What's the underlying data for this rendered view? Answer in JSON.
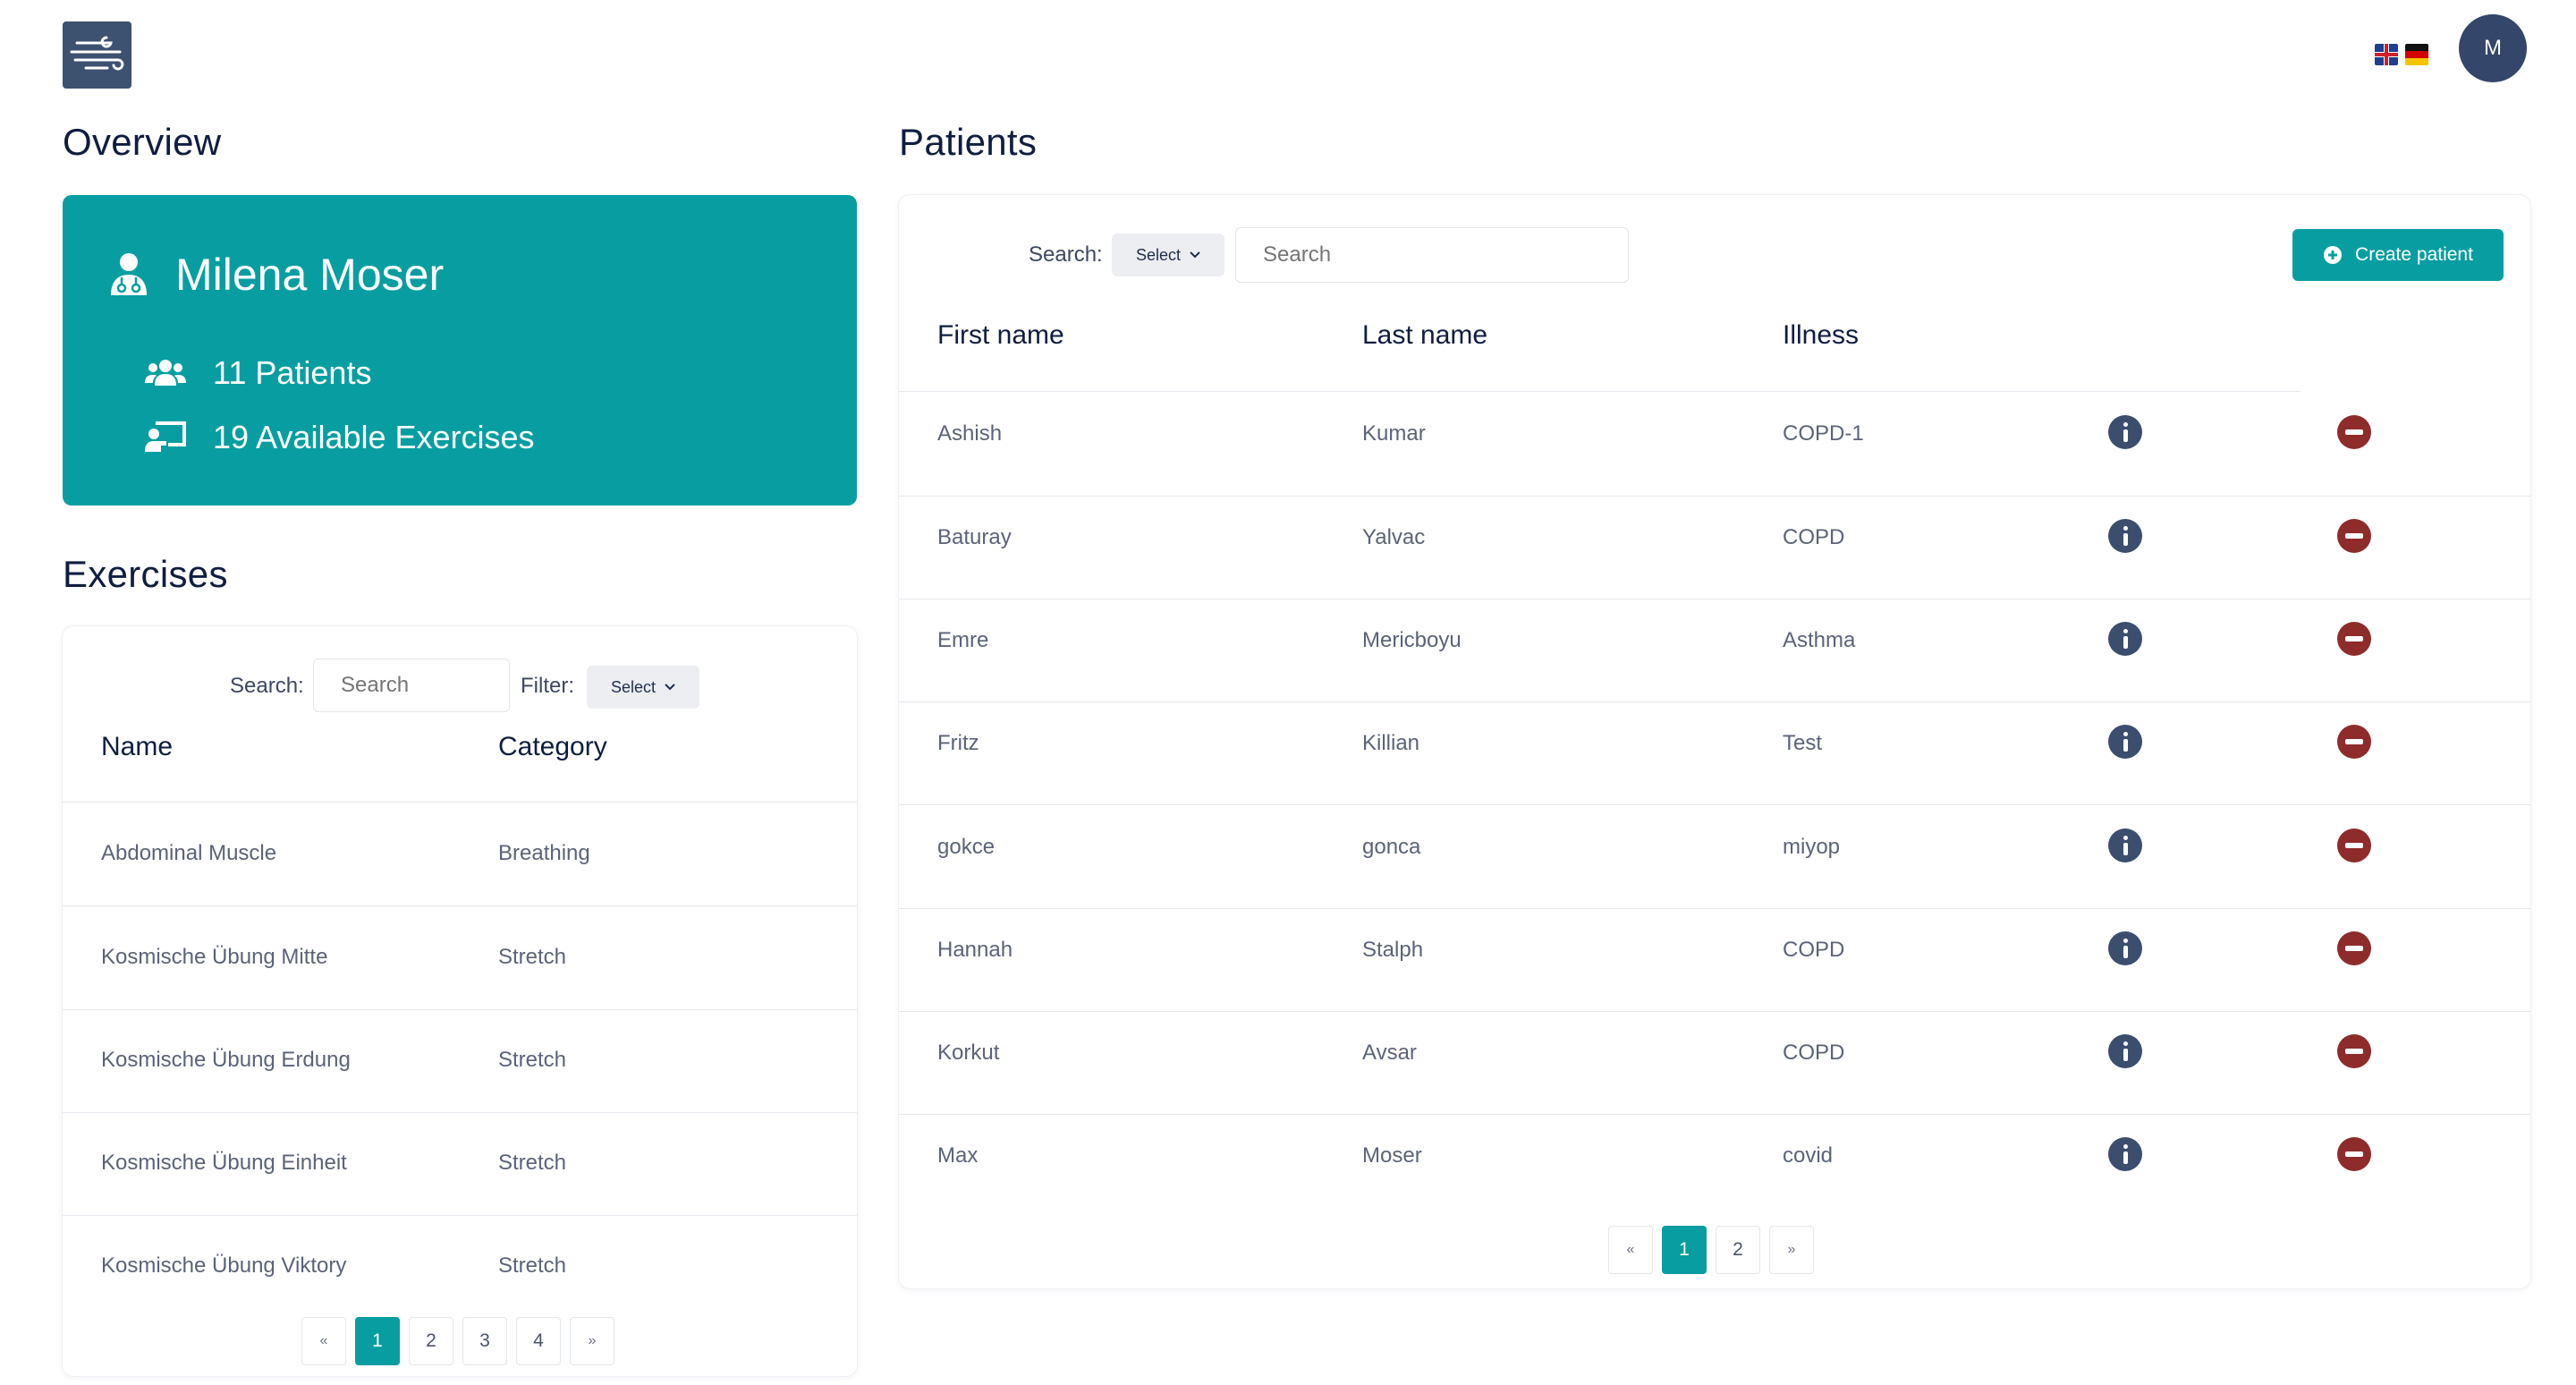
{
  "header": {
    "logo_icon": "wind-icon",
    "avatar_initial": "M",
    "languages": [
      "en",
      "de"
    ]
  },
  "overview": {
    "title": "Overview",
    "therapist_name": "Milena Moser",
    "patients_text": "11 Patients",
    "exercises_text": "19 Available Exercises"
  },
  "exercises": {
    "title": "Exercises",
    "search_label": "Search:",
    "search_placeholder": "Search",
    "filter_label": "Filter:",
    "filter_select": "Select",
    "columns": [
      "Name",
      "Category"
    ],
    "rows": [
      {
        "name": "Abdominal Muscle",
        "category": "Breathing"
      },
      {
        "name": "Kosmische Übung Mitte",
        "category": "Stretch"
      },
      {
        "name": "Kosmische Übung Erdung",
        "category": "Stretch"
      },
      {
        "name": "Kosmische Übung Einheit",
        "category": "Stretch"
      },
      {
        "name": "Kosmische Übung Viktory",
        "category": "Stretch"
      }
    ],
    "pagination": {
      "prev": "«",
      "pages": [
        "1",
        "2",
        "3",
        "4"
      ],
      "next": "»",
      "current": "1"
    }
  },
  "patients": {
    "title": "Patients",
    "search_label": "Search:",
    "search_select": "Select",
    "search_placeholder": "Search",
    "create_button": "Create patient",
    "columns": [
      "First name",
      "Last name",
      "Illness"
    ],
    "rows": [
      {
        "first": "Ashish",
        "last": "Kumar",
        "illness": "COPD-1"
      },
      {
        "first": "Baturay",
        "last": "Yalvac",
        "illness": "COPD"
      },
      {
        "first": "Emre",
        "last": "Mericboyu",
        "illness": "Asthma"
      },
      {
        "first": "Fritz",
        "last": "Killian",
        "illness": "Test"
      },
      {
        "first": "gokce",
        "last": "gonca",
        "illness": "miyop"
      },
      {
        "first": "Hannah",
        "last": "Stalph",
        "illness": "COPD"
      },
      {
        "first": "Korkut",
        "last": "Avsar",
        "illness": "COPD"
      },
      {
        "first": "Max",
        "last": "Moser",
        "illness": "covid"
      }
    ],
    "pagination": {
      "prev": "«",
      "pages": [
        "1",
        "2"
      ],
      "next": "»",
      "current": "1"
    }
  },
  "colors": {
    "accent": "#089ea1",
    "navy": "#3b4e6e",
    "danger": "#8e2b2b"
  }
}
